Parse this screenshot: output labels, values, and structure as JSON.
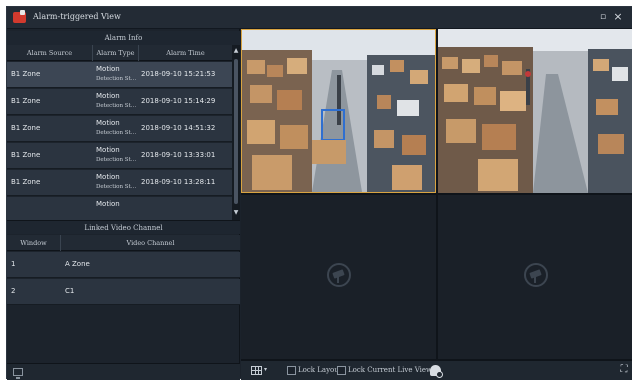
{
  "window": {
    "title": "Alarm-triggered View",
    "maximize_icon": "maximize-icon",
    "close_icon": "close-icon"
  },
  "alarm_info": {
    "heading": "Alarm Info",
    "columns": [
      "Alarm Source",
      "Alarm Type",
      "Alarm Time"
    ],
    "rows": [
      {
        "source": "B1 Zone",
        "type_line1": "Motion",
        "type_line2": "Detection St…",
        "time": "2018-09-10 15:21:53",
        "selected": true
      },
      {
        "source": "B1 Zone",
        "type_line1": "Motion",
        "type_line2": "Detection St…",
        "time": "2018-09-10 15:14:29",
        "selected": false
      },
      {
        "source": "B1 Zone",
        "type_line1": "Motion",
        "type_line2": "Detection St…",
        "time": "2018-09-10 14:51:32",
        "selected": false
      },
      {
        "source": "B1 Zone",
        "type_line1": "Motion",
        "type_line2": "Detection St…",
        "time": "2018-09-10 13:33:01",
        "selected": false
      },
      {
        "source": "B1 Zone",
        "type_line1": "Motion",
        "type_line2": "Detection St…",
        "time": "2018-09-10 13:28:11",
        "selected": false
      },
      {
        "source": "",
        "type_line1": "Motion",
        "type_line2": "",
        "time": "",
        "selected": false
      }
    ]
  },
  "linked_video": {
    "heading": "Linked Video Channel",
    "columns": [
      "Window",
      "Video Channel"
    ],
    "rows": [
      {
        "window": "1",
        "channel": "A Zone"
      },
      {
        "window": "2",
        "channel": "C1"
      }
    ]
  },
  "toolbar": {
    "layout_icon": "grid-layout-icon",
    "layout_caret": "▾",
    "lock_layout_label": "Lock Layout",
    "lock_view_label": "Lock Current Live View",
    "lock_layout_checked": false,
    "lock_view_checked": false,
    "snapshot_icon": "person-capture-icon",
    "fullscreen_icon": "fullscreen-icon"
  },
  "colors": {
    "selected_window_border": "#d9a441",
    "app_icon": "#d23a2e"
  }
}
